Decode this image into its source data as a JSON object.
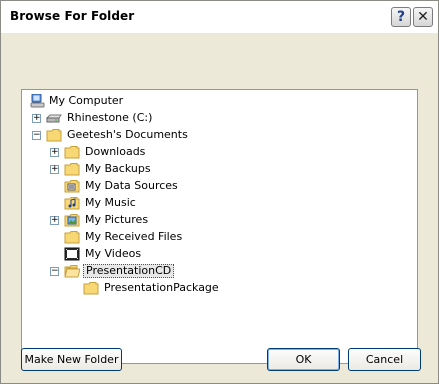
{
  "dialog": {
    "title": "Browse For Folder",
    "help_glyph": "?",
    "close_glyph": "✕"
  },
  "tree": {
    "items": [
      {
        "label": "My Computer",
        "icon": "computer-icon",
        "expander": ""
      },
      {
        "label": "Rhinestone (C:)",
        "icon": "drive-icon",
        "expander": "+"
      },
      {
        "label": "Geetesh's Documents",
        "icon": "folder-icon",
        "expander": "−"
      },
      {
        "label": "Downloads",
        "icon": "folder-icon",
        "expander": "+"
      },
      {
        "label": "My Backups",
        "icon": "folder-icon",
        "expander": "+"
      },
      {
        "label": "My Data Sources",
        "icon": "data-sources-icon",
        "expander": ""
      },
      {
        "label": "My Music",
        "icon": "music-folder-icon",
        "expander": ""
      },
      {
        "label": "My Pictures",
        "icon": "pictures-folder-icon",
        "expander": "+"
      },
      {
        "label": "My Received Files",
        "icon": "folder-icon",
        "expander": ""
      },
      {
        "label": "My Videos",
        "icon": "videos-folder-icon",
        "expander": ""
      },
      {
        "label": "PresentationCD",
        "icon": "open-folder-icon",
        "expander": "−",
        "selected": true
      },
      {
        "label": "PresentationPackage",
        "icon": "folder-icon",
        "expander": ""
      }
    ]
  },
  "buttons": {
    "make_new_folder": "Make New Folder",
    "ok": "OK",
    "cancel": "Cancel"
  },
  "colors": {
    "dialog_face": "#ece9d8",
    "tree_border": "#7f9db9",
    "folder_yellow": "#f8d775",
    "button_border": "#003c74"
  }
}
